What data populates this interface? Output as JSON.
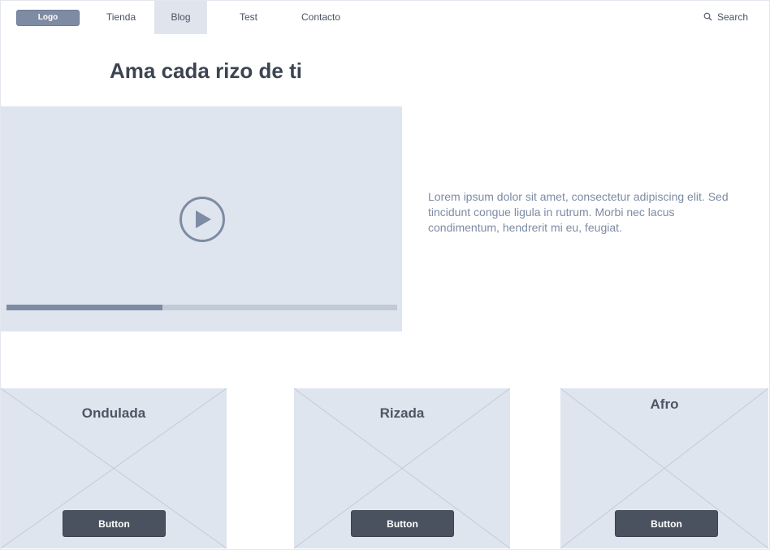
{
  "nav": {
    "logo": "Logo",
    "items": [
      {
        "label": "Tienda",
        "active": false
      },
      {
        "label": "Blog",
        "active": true
      },
      {
        "label": "Test",
        "active": false
      },
      {
        "label": "Contacto",
        "active": false
      }
    ],
    "search_label": "Search",
    "search_icon": "search-icon"
  },
  "hero": {
    "title": "Ama cada rizo de ti",
    "description": "Lorem ipsum dolor sit amet, consectetur adipiscing elit. Sed tincidunt congue ligula in rutrum. Morbi nec lacus condimentum, hendrerit mi eu, feugiat."
  },
  "video": {
    "play_icon": "play-icon",
    "progress": 0.4
  },
  "cards": [
    {
      "title": "Ondulada",
      "button": "Button"
    },
    {
      "title": "Rizada",
      "button": "Button"
    },
    {
      "title": "Afro",
      "button": "Button"
    }
  ],
  "colors": {
    "placeholder_bg": "#dfe5ee",
    "accent": "#7d8ba3",
    "button_bg": "#4a5260",
    "text_dark": "#3d4451"
  }
}
